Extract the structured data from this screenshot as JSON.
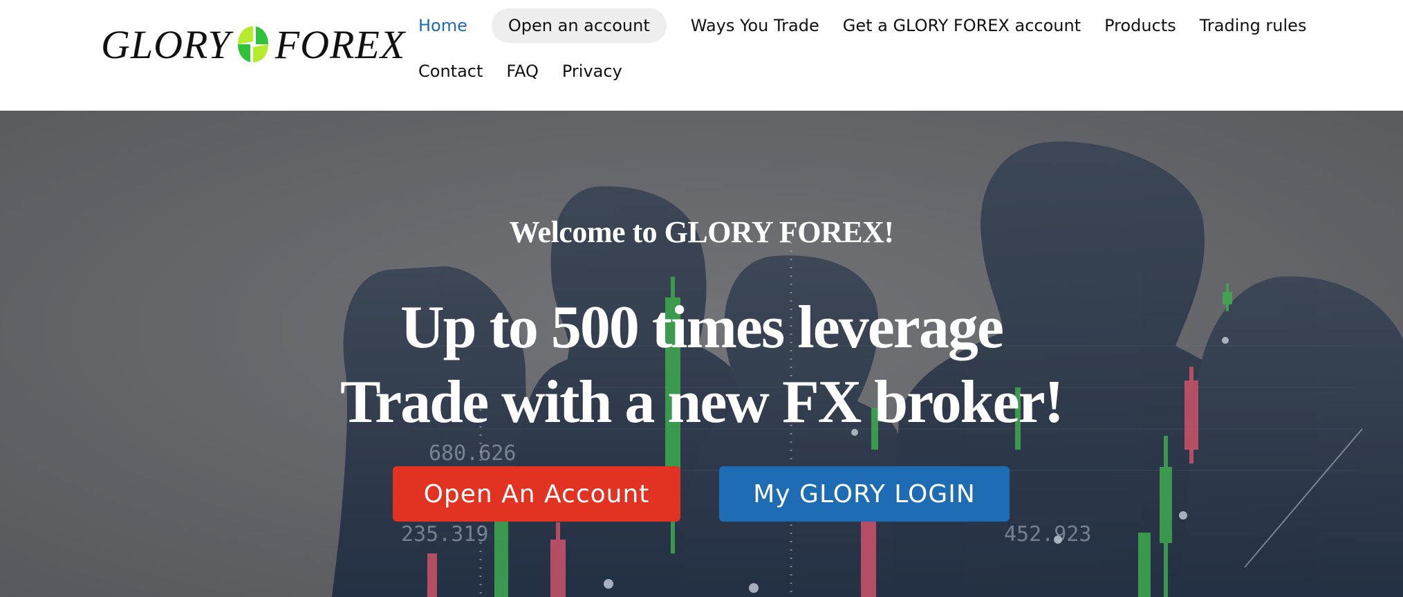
{
  "logo": {
    "left": "GLORY",
    "right": "FOREX",
    "icon": "clover-logo-icon"
  },
  "nav": {
    "row1": [
      {
        "label": "Home",
        "active": true
      },
      {
        "label": "Open an account",
        "highlighted": true
      },
      {
        "label": "Ways You Trade"
      },
      {
        "label": "Get a GLORY FOREX account"
      },
      {
        "label": "Products"
      },
      {
        "label": "Trading rules"
      }
    ],
    "row2": [
      {
        "label": "Contact"
      },
      {
        "label": "FAQ"
      },
      {
        "label": "Privacy"
      }
    ]
  },
  "hero": {
    "welcome": "Welcome to GLORY FOREX!",
    "headline_line1": "Up to 500 times leverage",
    "headline_line2": "Trade with a new FX broker!",
    "primary_button": "Open An Account",
    "secondary_button": "My GLORY LOGIN",
    "ticker_values": [
      "680.626",
      "235.319",
      "452.923"
    ]
  },
  "colors": {
    "nav_active": "#1f6ab0",
    "primary_button": "#e23322",
    "secondary_button": "#1e6cb3",
    "candle_up": "#3fb950",
    "candle_down": "#e0566e"
  }
}
